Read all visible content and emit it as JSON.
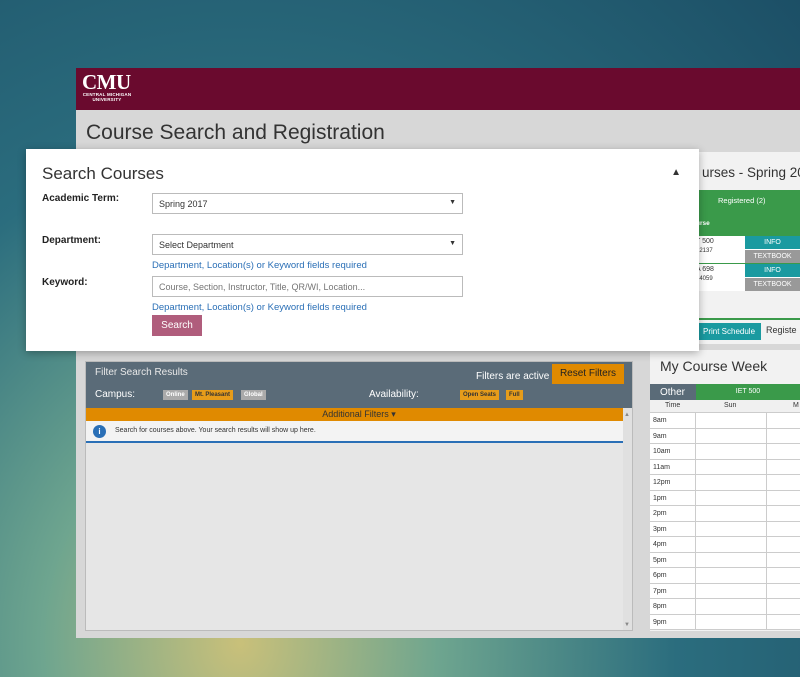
{
  "header": {
    "logo_text": "CMU",
    "logo_subtitle": "CENTRAL MICHIGAN UNIVERSITY",
    "brand_color": "#6a0a2e"
  },
  "page_title": "Course Search and Registration",
  "search": {
    "title": "Search Courses",
    "term_label": "Academic Term:",
    "term_value": "Spring 2017",
    "department_label": "Department:",
    "department_value": "Select Department",
    "required_note": "Department, Location(s) or Keyword fields required",
    "keyword_label": "Keyword:",
    "keyword_placeholder": "Course, Section, Instructor, Title, QR/WI, Location...",
    "search_button": "Search"
  },
  "filters": {
    "title": "Filter Search Results",
    "active_text": "Filters are active",
    "reset_button": "Reset Filters",
    "campus_label": "Campus:",
    "campus_options": [
      "Online",
      "Mt. Pleasant",
      "Global"
    ],
    "availability_label": "Availability:",
    "availability_options": [
      "Open Seats",
      "Full"
    ],
    "additional_filters": "Additional Filters",
    "info_text": "Search for courses above. Your search results will show up here."
  },
  "registered": {
    "title": "urses - Spring 20",
    "registered_tab": "Registered (2)",
    "column_course": "urse",
    "courses": [
      {
        "code": "T 500",
        "number": "22137",
        "info": "INFO",
        "textbook": "TEXTBOOK"
      },
      {
        "code": "A 698",
        "number": "24059",
        "info": "INFO",
        "textbook": "TEXTBOOK"
      }
    ],
    "print_button": "Print Schedule",
    "register_text": "Registe"
  },
  "week": {
    "title": "My Course Week",
    "other_label": "Other",
    "iet_tag": "IET 500",
    "col_time": "Time",
    "col_sun": "Sun",
    "col_mon": "M",
    "times": [
      "8am",
      "9am",
      "10am",
      "11am",
      "12pm",
      "1pm",
      "2pm",
      "3pm",
      "4pm",
      "5pm",
      "6pm",
      "7pm",
      "8pm",
      "9pm"
    ]
  }
}
